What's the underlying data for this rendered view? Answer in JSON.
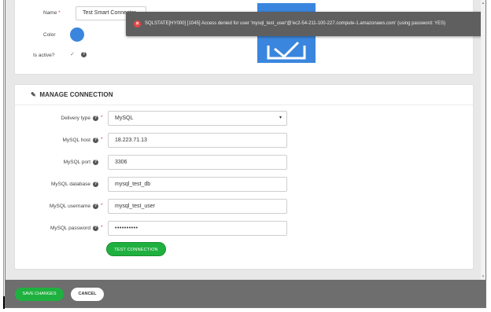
{
  "top_card": {
    "name_label": "Name",
    "name_required": "*",
    "name_value": "Test Smart Connector",
    "color_label": "Color",
    "color_value": "#3a86de",
    "active_label": "Is active?",
    "active_checked": true,
    "active_check_glyph": "✓",
    "info_glyph": "?"
  },
  "error_toast": {
    "icon": "error-icon",
    "icon_glyph": "×",
    "message": "SQLSTATE[HY000] [1045] Access denied for user 'mysql_test_user'@'ec2-54-211-100-227.compute-1.amazonaws.com' (using password: YES)"
  },
  "connection": {
    "header": "MANAGE CONNECTION",
    "header_icon": "plug-icon",
    "header_icon_glyph": "✎",
    "fields": {
      "delivery_type": {
        "label": "Delivery type",
        "required": "*",
        "value": "MySQL",
        "caret": "▾"
      },
      "host": {
        "label": "MySQL host",
        "required": "*",
        "value": "18.223.71.13"
      },
      "port": {
        "label": "MySQL port",
        "required": "",
        "value": "3306"
      },
      "database": {
        "label": "MySQL database",
        "required": "",
        "value": "mysql_test_db"
      },
      "username": {
        "label": "MySQL username",
        "required": "*",
        "value": "mysql_test_user"
      },
      "password": {
        "label": "MySQL password",
        "required": "*",
        "value": "••••••••••"
      }
    },
    "test_button": "TEST CONNECTION"
  },
  "footer": {
    "save_button": "SAVE CHANGES",
    "cancel_button": "CANCEL"
  },
  "colors": {
    "accent_green": "#20b040",
    "toast_bg": "#5f5f5f",
    "error_red": "#e84545",
    "brand_blue": "#3a86de"
  }
}
